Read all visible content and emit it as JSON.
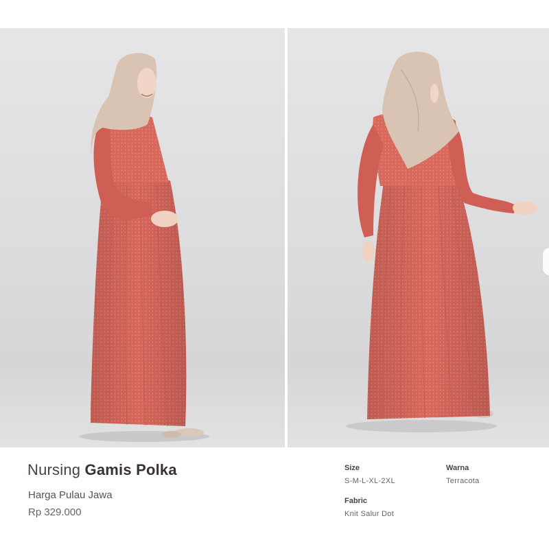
{
  "product": {
    "title_prefix": "Nursing",
    "title_name": "Gamis Polka",
    "price_label": "Harga Pulau Jawa",
    "price_value": "Rp 329.000"
  },
  "specs": {
    "size_label": "Size",
    "size_value": "S-M-L-XL-2XL",
    "color_label": "Warna",
    "color_value": "Terracota",
    "fabric_label": "Fabric",
    "fabric_value": "Knit Salur Dot"
  },
  "colors": {
    "dress": "#d8675c",
    "hijab": "#d9c4b3",
    "backdrop": "#dcdcde"
  }
}
